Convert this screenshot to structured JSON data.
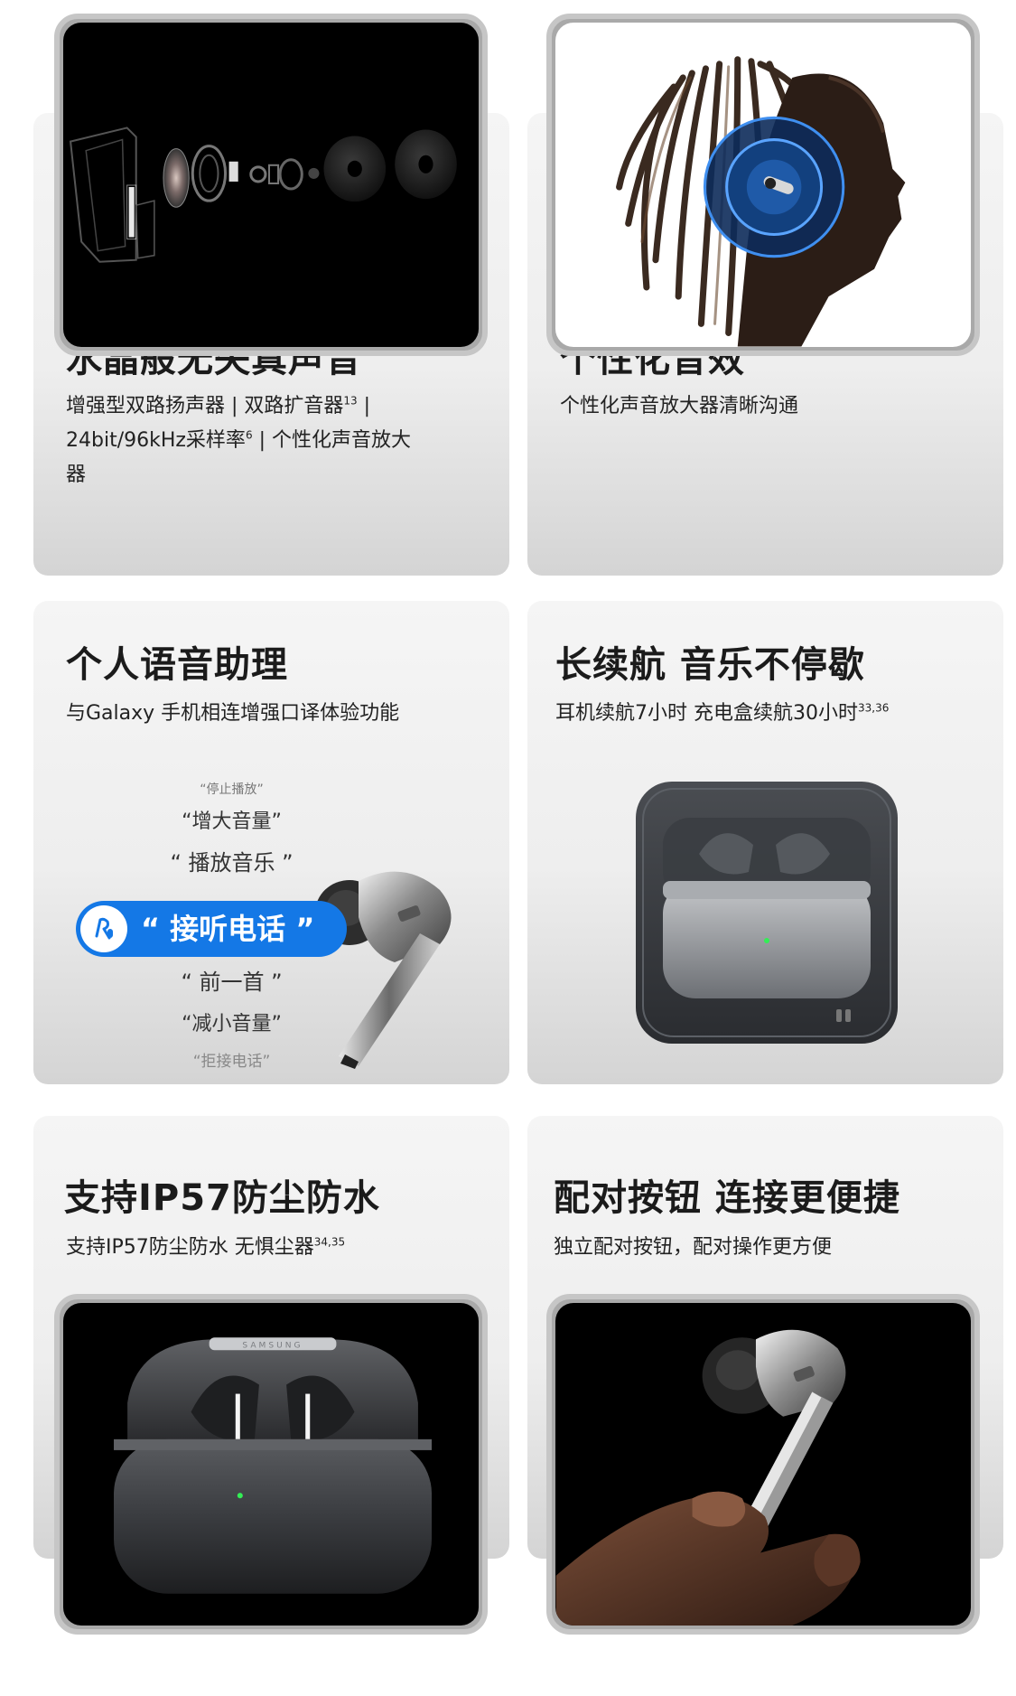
{
  "cards": [
    {
      "title": "水晶般无失真声音",
      "desc_line1": "增强型双路扬声器 | 双路扩音器",
      "desc_line1_sup": "13",
      "desc_line1_tail": " |",
      "desc_line2": "24bit/96kHz采样率",
      "desc_line2_sup": "6",
      "desc_line2_tail": " | 个性化声音放大",
      "desc_line3": "器"
    },
    {
      "title": "个性化音效",
      "desc": "个性化声音放大器清晰沟通"
    },
    {
      "title": "个人语音助理",
      "desc": "与Galaxy 手机相连增强口译体验功能",
      "voice_commands": [
        "“停止播放”",
        "“增大音量”",
        "“ 播放音乐 ”",
        "“ 接听电话 ”",
        "“ 前一首 ”",
        "“减小音量”",
        "“拒接电话”"
      ]
    },
    {
      "title": "长续航 音乐不停歇",
      "desc": "耳机续航7小时 充电盒续航30小时",
      "desc_sup": "33,36"
    },
    {
      "title": "支持IP57防尘防水",
      "desc": "支持IP57防尘防水  无惧尘器",
      "desc_sup": "34,35"
    },
    {
      "title": "配对按钮 连接更便捷",
      "desc": "独立配对按钮，配对操作更方便"
    }
  ],
  "case_brand": "SAMSUNG",
  "colors": {
    "assistant_pill": "#1478e6",
    "card_gradient_top": "#f5f5f5",
    "card_gradient_bottom": "#d4d4d4",
    "frame_border": "#c6c6c6",
    "led_green": "#33ee55"
  },
  "icons": [
    "voice-assistant-icon"
  ]
}
